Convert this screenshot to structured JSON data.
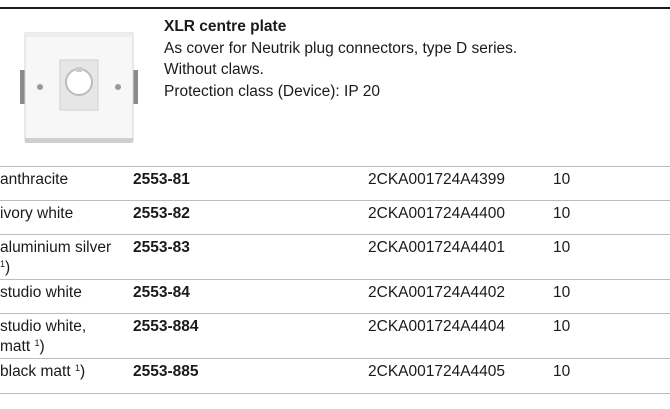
{
  "product": {
    "title": "XLR centre plate",
    "description_lines": [
      "As cover for Neutrik plug connectors, type D series.",
      "Without claws.",
      "Protection class (Device): IP 20"
    ]
  },
  "variants": [
    {
      "color": "anthracite",
      "footnote": "",
      "article": "2553-81",
      "order_code": "2CKA001724A4399",
      "pack_qty": "10"
    },
    {
      "color": "ivory white",
      "footnote": "",
      "article": "2553-82",
      "order_code": "2CKA001724A4400",
      "pack_qty": "10"
    },
    {
      "color": "aluminium silver",
      "footnote": "1",
      "article": "2553-83",
      "order_code": "2CKA001724A4401",
      "pack_qty": "10"
    },
    {
      "color": "studio white",
      "footnote": "",
      "article": "2553-84",
      "order_code": "2CKA001724A4402",
      "pack_qty": "10"
    },
    {
      "color": "studio white, matt",
      "footnote": "1",
      "article": "2553-884",
      "order_code": "2CKA001724A4404",
      "pack_qty": "10"
    },
    {
      "color": "black matt",
      "footnote": "1",
      "article": "2553-885",
      "order_code": "2CKA001724A4405",
      "pack_qty": "10"
    }
  ]
}
